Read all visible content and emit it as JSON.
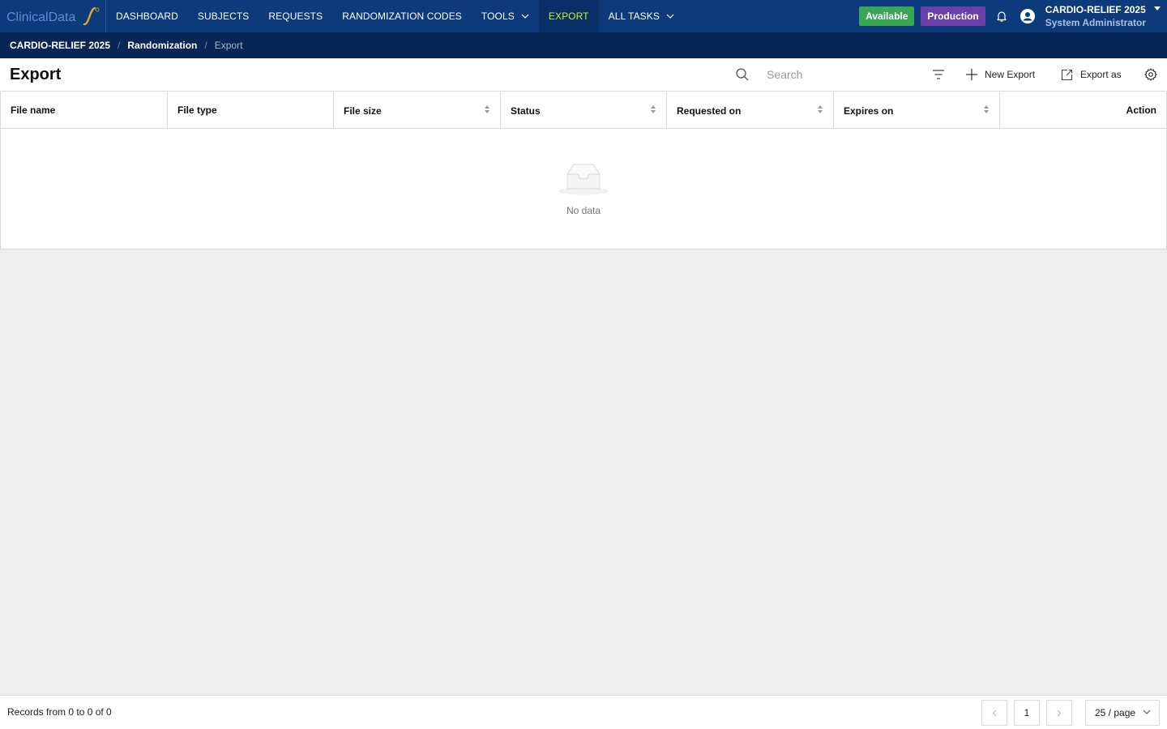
{
  "app": {
    "logo_text": "ClinicalData"
  },
  "nav": {
    "items": [
      {
        "label": "DASHBOARD"
      },
      {
        "label": "SUBJECTS"
      },
      {
        "label": "REQUESTS"
      },
      {
        "label": "RANDOMIZATION CODES"
      },
      {
        "label": "TOOLS"
      },
      {
        "label": "EXPORT"
      },
      {
        "label": "ALL TASKS"
      }
    ],
    "active": "EXPORT",
    "status_badge": "Available",
    "env_badge": "Production",
    "user_study": "CARDIO-RELIEF 2025",
    "user_role": "System Administrator"
  },
  "breadcrumb": {
    "items": [
      "CARDIO-RELIEF 2025",
      "Randomization",
      "Export"
    ],
    "separator": "/"
  },
  "header": {
    "title": "Export",
    "search_placeholder": "Search",
    "new_export_label": "New Export",
    "export_as_label": "Export as"
  },
  "table": {
    "columns": [
      {
        "label": "File name",
        "sortable": false
      },
      {
        "label": "File type",
        "sortable": false
      },
      {
        "label": "File size",
        "sortable": true
      },
      {
        "label": "Status",
        "sortable": true
      },
      {
        "label": "Requested on",
        "sortable": true
      },
      {
        "label": "Expires on",
        "sortable": true
      },
      {
        "label": "Action",
        "sortable": false
      }
    ],
    "rows": [],
    "empty_text": "No data"
  },
  "footer": {
    "records_text": "Records from 0 to 0 of 0",
    "current_page": "1",
    "page_size": "25 / page"
  },
  "colors": {
    "nav_bg": "#0d3a7a",
    "breadcrumb_bg": "#082756",
    "active_nav_text": "#c7ef3c",
    "available": "#3aa757",
    "production": "#6a3fa8"
  }
}
